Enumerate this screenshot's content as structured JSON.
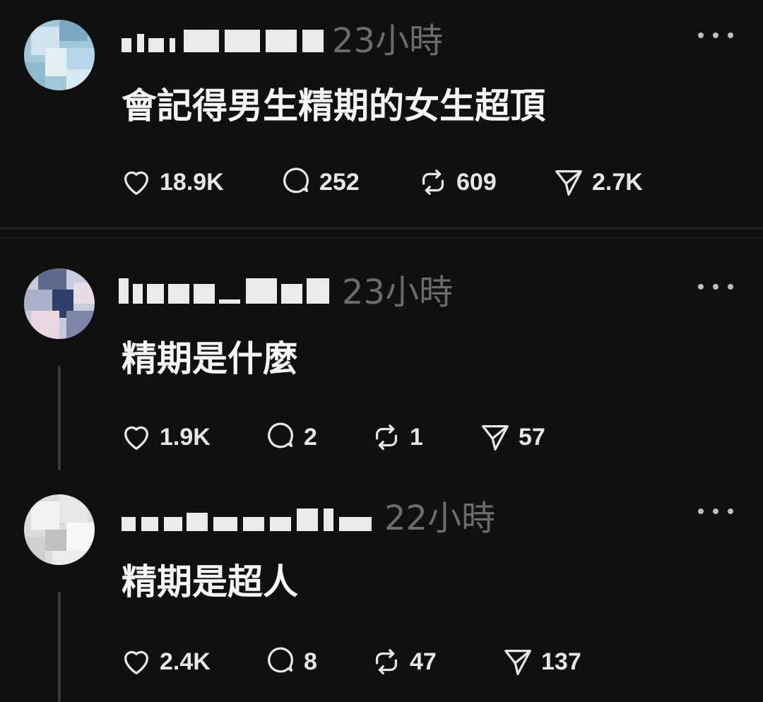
{
  "posts": [
    {
      "time": "23小時",
      "text": "會記得男生精期的女生超頂",
      "likes": "18.9K",
      "comments": "252",
      "reposts": "609",
      "shares": "2.7K"
    },
    {
      "time": "23小時",
      "text": "精期是什麼",
      "likes": "1.9K",
      "comments": "2",
      "reposts": "1",
      "shares": "57"
    },
    {
      "time": "22小時",
      "text": "精期是超人",
      "likes": "2.4K",
      "comments": "8",
      "reposts": "47",
      "shares": "137"
    }
  ],
  "icons": {
    "like": "heart-icon",
    "comment": "comment-bubble-icon",
    "repost": "repost-icon",
    "share": "send-icon",
    "more": "more-icon"
  },
  "colors": {
    "background": "#101010",
    "text": "#f5f5f5",
    "muted": "#6b6b6b"
  }
}
